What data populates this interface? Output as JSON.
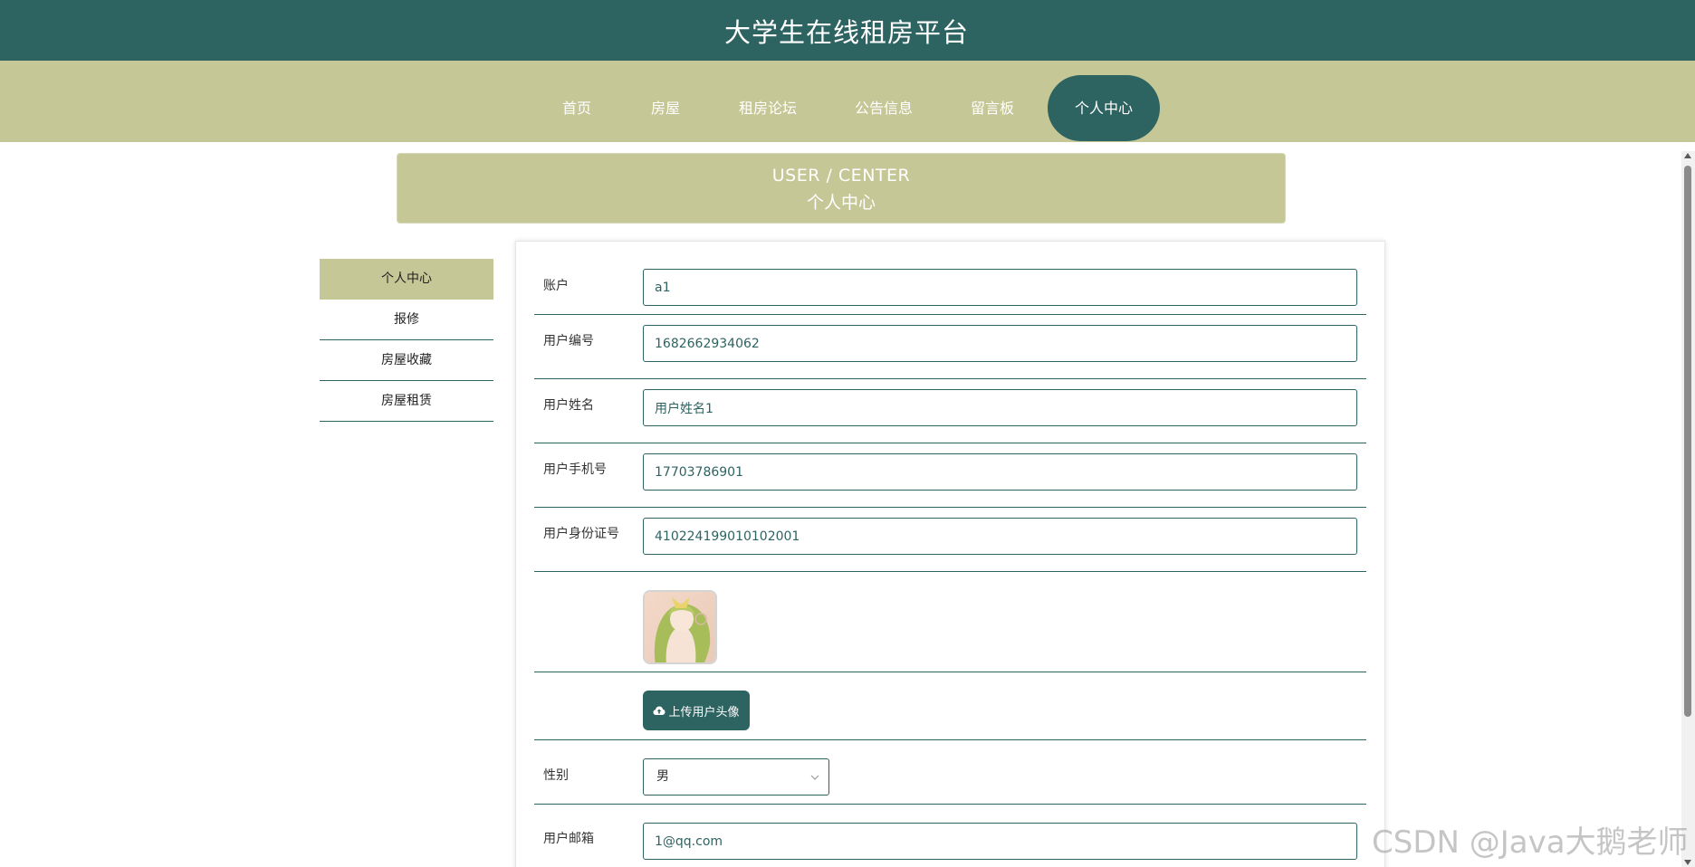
{
  "site": {
    "title": "大学生在线租房平台"
  },
  "nav": {
    "items": [
      {
        "label": "首页"
      },
      {
        "label": "房屋"
      },
      {
        "label": "租房论坛"
      },
      {
        "label": "公告信息"
      },
      {
        "label": "留言板"
      },
      {
        "label": "个人中心",
        "active": true
      }
    ]
  },
  "banner": {
    "en": "USER / CENTER",
    "cn": "个人中心"
  },
  "sidebar": {
    "items": [
      {
        "label": "个人中心",
        "active": true
      },
      {
        "label": "报修"
      },
      {
        "label": "房屋收藏"
      },
      {
        "label": "房屋租赁"
      }
    ]
  },
  "form": {
    "account": {
      "label": "账户",
      "value": "a1"
    },
    "user_no": {
      "label": "用户编号",
      "value": "1682662934062"
    },
    "user_name": {
      "label": "用户姓名",
      "value": "用户姓名1"
    },
    "phone": {
      "label": "用户手机号",
      "value": "17703786901"
    },
    "id_card": {
      "label": "用户身份证号",
      "value": "410224199010102001"
    },
    "upload_button": "上传用户头像",
    "gender": {
      "label": "性别",
      "value": "男"
    },
    "email": {
      "label": "用户邮箱",
      "value": "1@qq.com"
    }
  },
  "watermark": "CSDN @Java大鹅老师",
  "colors": {
    "primary": "#2d6361",
    "accent": "#c5c797"
  }
}
